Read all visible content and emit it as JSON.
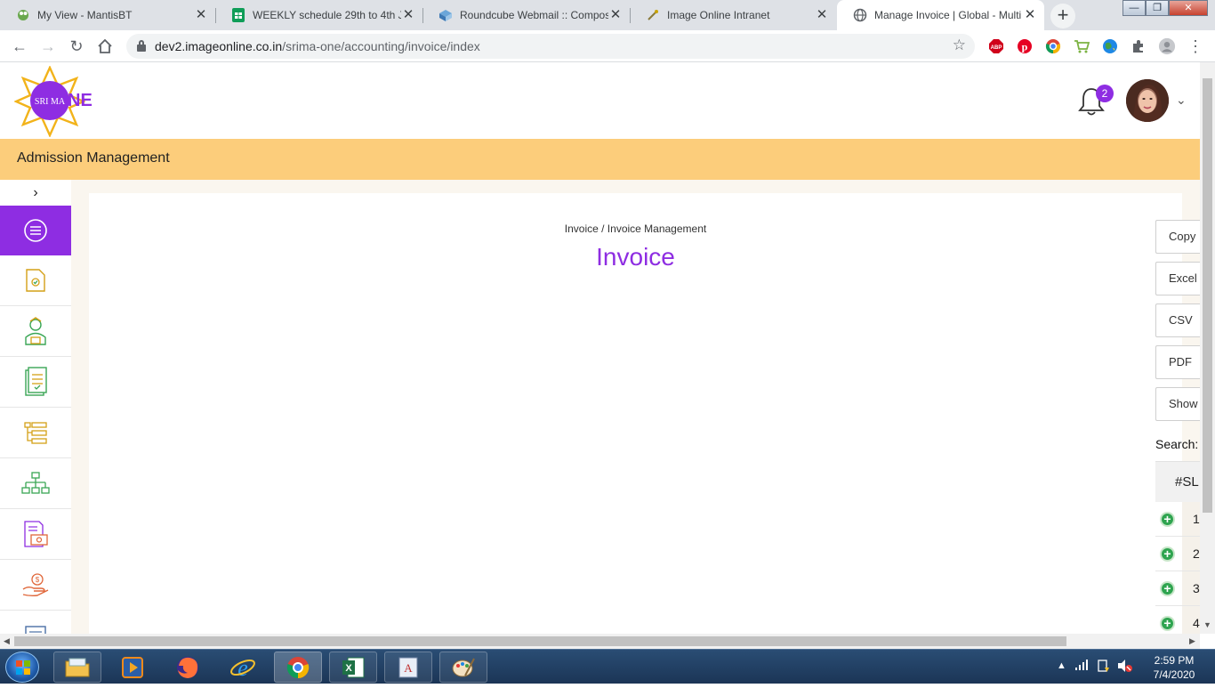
{
  "browser": {
    "tabs": [
      {
        "title": "My View - MantisBT",
        "icon": "mantis-icon",
        "active": false
      },
      {
        "title": "WEEKLY schedule 29th to 4th Ju",
        "icon": "google-sheets-icon",
        "active": false
      },
      {
        "title": "Roundcube Webmail :: Compos",
        "icon": "roundcube-icon",
        "active": false
      },
      {
        "title": "Image Online Intranet",
        "icon": "intranet-icon",
        "active": false
      },
      {
        "title": "Manage Invoice | Global - Multi",
        "icon": "globe-icon",
        "active": true
      }
    ],
    "url_host": "dev2.imageonline.co.in",
    "url_path": "/srima-one/accounting/invoice/index",
    "extensions": [
      "adblock-icon",
      "pinterest-icon",
      "chrome-ext-icon",
      "cart-icon",
      "globe-ext-icon",
      "puzzle-icon",
      "profile-icon",
      "menu-dots-icon"
    ]
  },
  "header": {
    "logo_text": "SRI MA",
    "logo_suffix": "NE",
    "notification_count": "2"
  },
  "module": {
    "title": "Admission Management"
  },
  "sidebar": {
    "toggle": "›",
    "items": [
      {
        "icon": "hamburger-menu-icon"
      },
      {
        "icon": "document-check-icon"
      },
      {
        "icon": "student-icon"
      },
      {
        "icon": "clipboard-list-icon"
      },
      {
        "icon": "list-tree-icon"
      },
      {
        "icon": "org-chart-icon"
      },
      {
        "icon": "invoice-icon"
      },
      {
        "icon": "hand-money-icon"
      },
      {
        "icon": "notes-icon"
      }
    ]
  },
  "content": {
    "breadcrumb": "Invoice / Invoice Management",
    "title": "Invoice",
    "buttons": {
      "copy": "Copy",
      "excel": "Excel",
      "csv": "CSV",
      "pdf": "PDF",
      "show": "Show"
    },
    "search_label": "Search:",
    "table": {
      "header": "#SL",
      "rows": [
        "1",
        "2",
        "3",
        "4"
      ]
    }
  },
  "taskbar": {
    "time": "2:59 PM",
    "date": "7/4/2020",
    "apps": [
      "file-explorer-icon",
      "media-player-icon",
      "firefox-icon",
      "internet-explorer-icon",
      "chrome-icon",
      "excel-icon",
      "word-icon",
      "paint-icon"
    ]
  },
  "colors": {
    "brand_purple": "#8e2de2",
    "module_bar": "#fccd7b",
    "icon_gold": "#d4a017",
    "icon_green": "#3aa655"
  }
}
